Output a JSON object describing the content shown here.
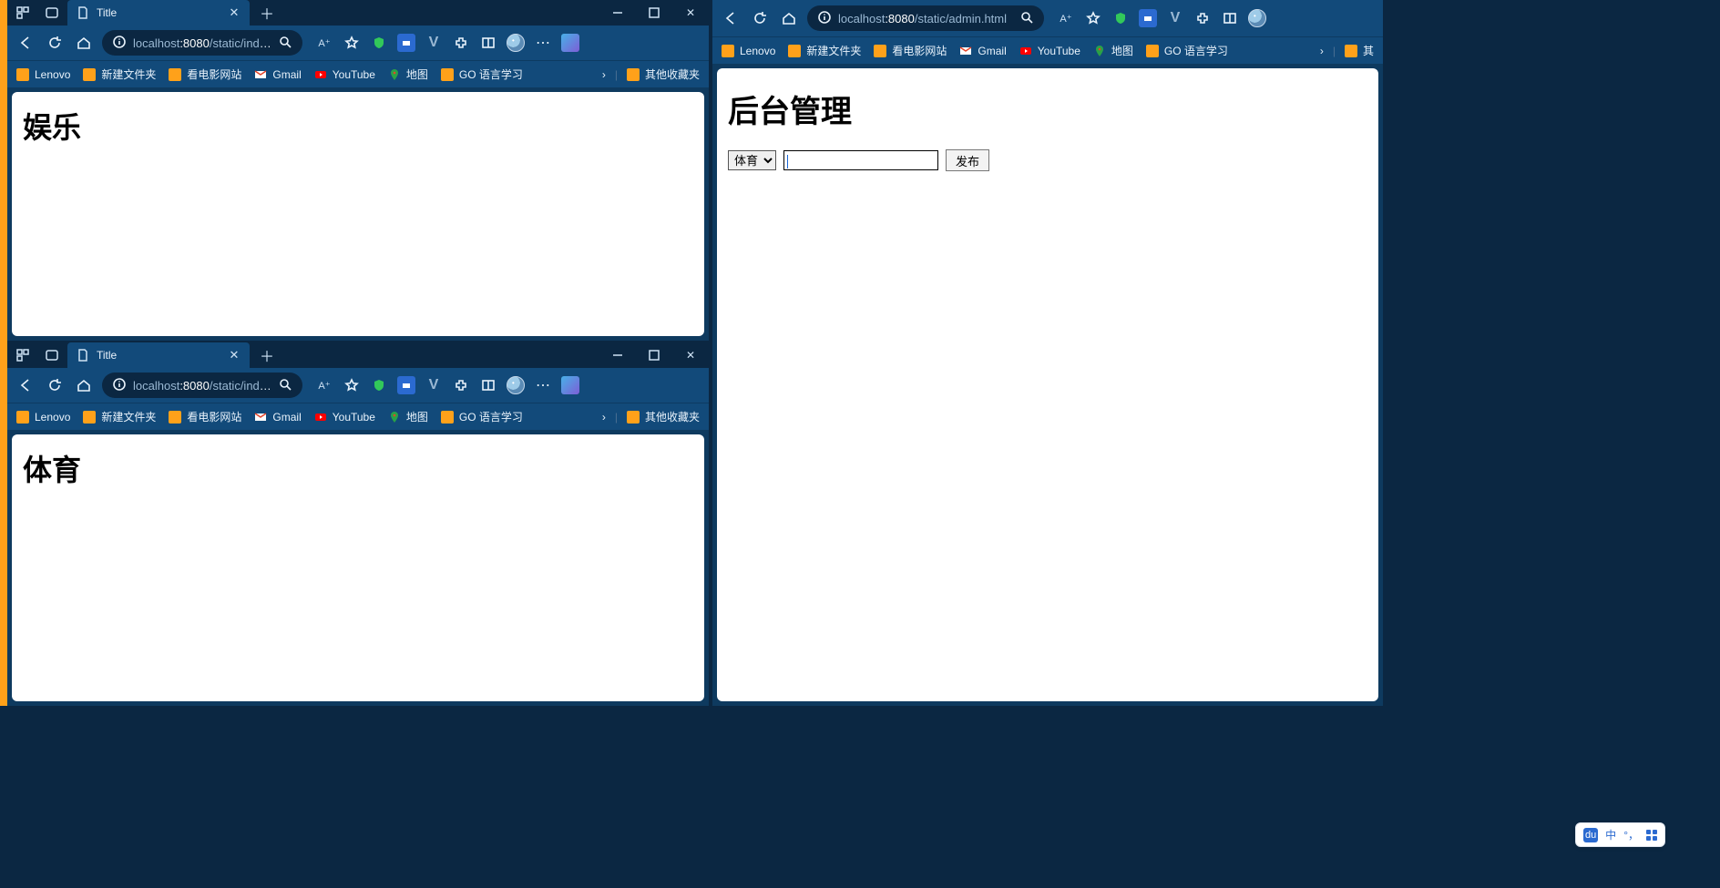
{
  "bookmarks": [
    {
      "label": "Lenovo",
      "icon": "folder"
    },
    {
      "label": "新建文件夹",
      "icon": "folder"
    },
    {
      "label": "看电影网站",
      "icon": "folder"
    },
    {
      "label": "Gmail",
      "icon": "gmail"
    },
    {
      "label": "YouTube",
      "icon": "youtube"
    },
    {
      "label": "地图",
      "icon": "maps"
    },
    {
      "label": "GO 语言学习",
      "icon": "folder"
    }
  ],
  "other_favorites_label": "其他收藏夹",
  "partial_bookmark_label": "其",
  "windows": {
    "w1": {
      "tab_title": "Title",
      "url_host_dim": "localhost",
      "url_port": ":8080",
      "url_path": "/static/index…",
      "page_heading": "娱乐"
    },
    "w2": {
      "tab_title": "Title",
      "url_host_dim": "localhost",
      "url_port": ":8080",
      "url_path": "/static/index…",
      "page_heading": "体育"
    },
    "w3": {
      "url_host_dim": "localhost",
      "url_port": ":8080",
      "url_path": "/static/admin.html",
      "page_heading": "后台管理",
      "select_value": "体育",
      "input_value": "",
      "button_label": "发布"
    }
  },
  "ime": {
    "badge": "du",
    "lang": "中"
  }
}
